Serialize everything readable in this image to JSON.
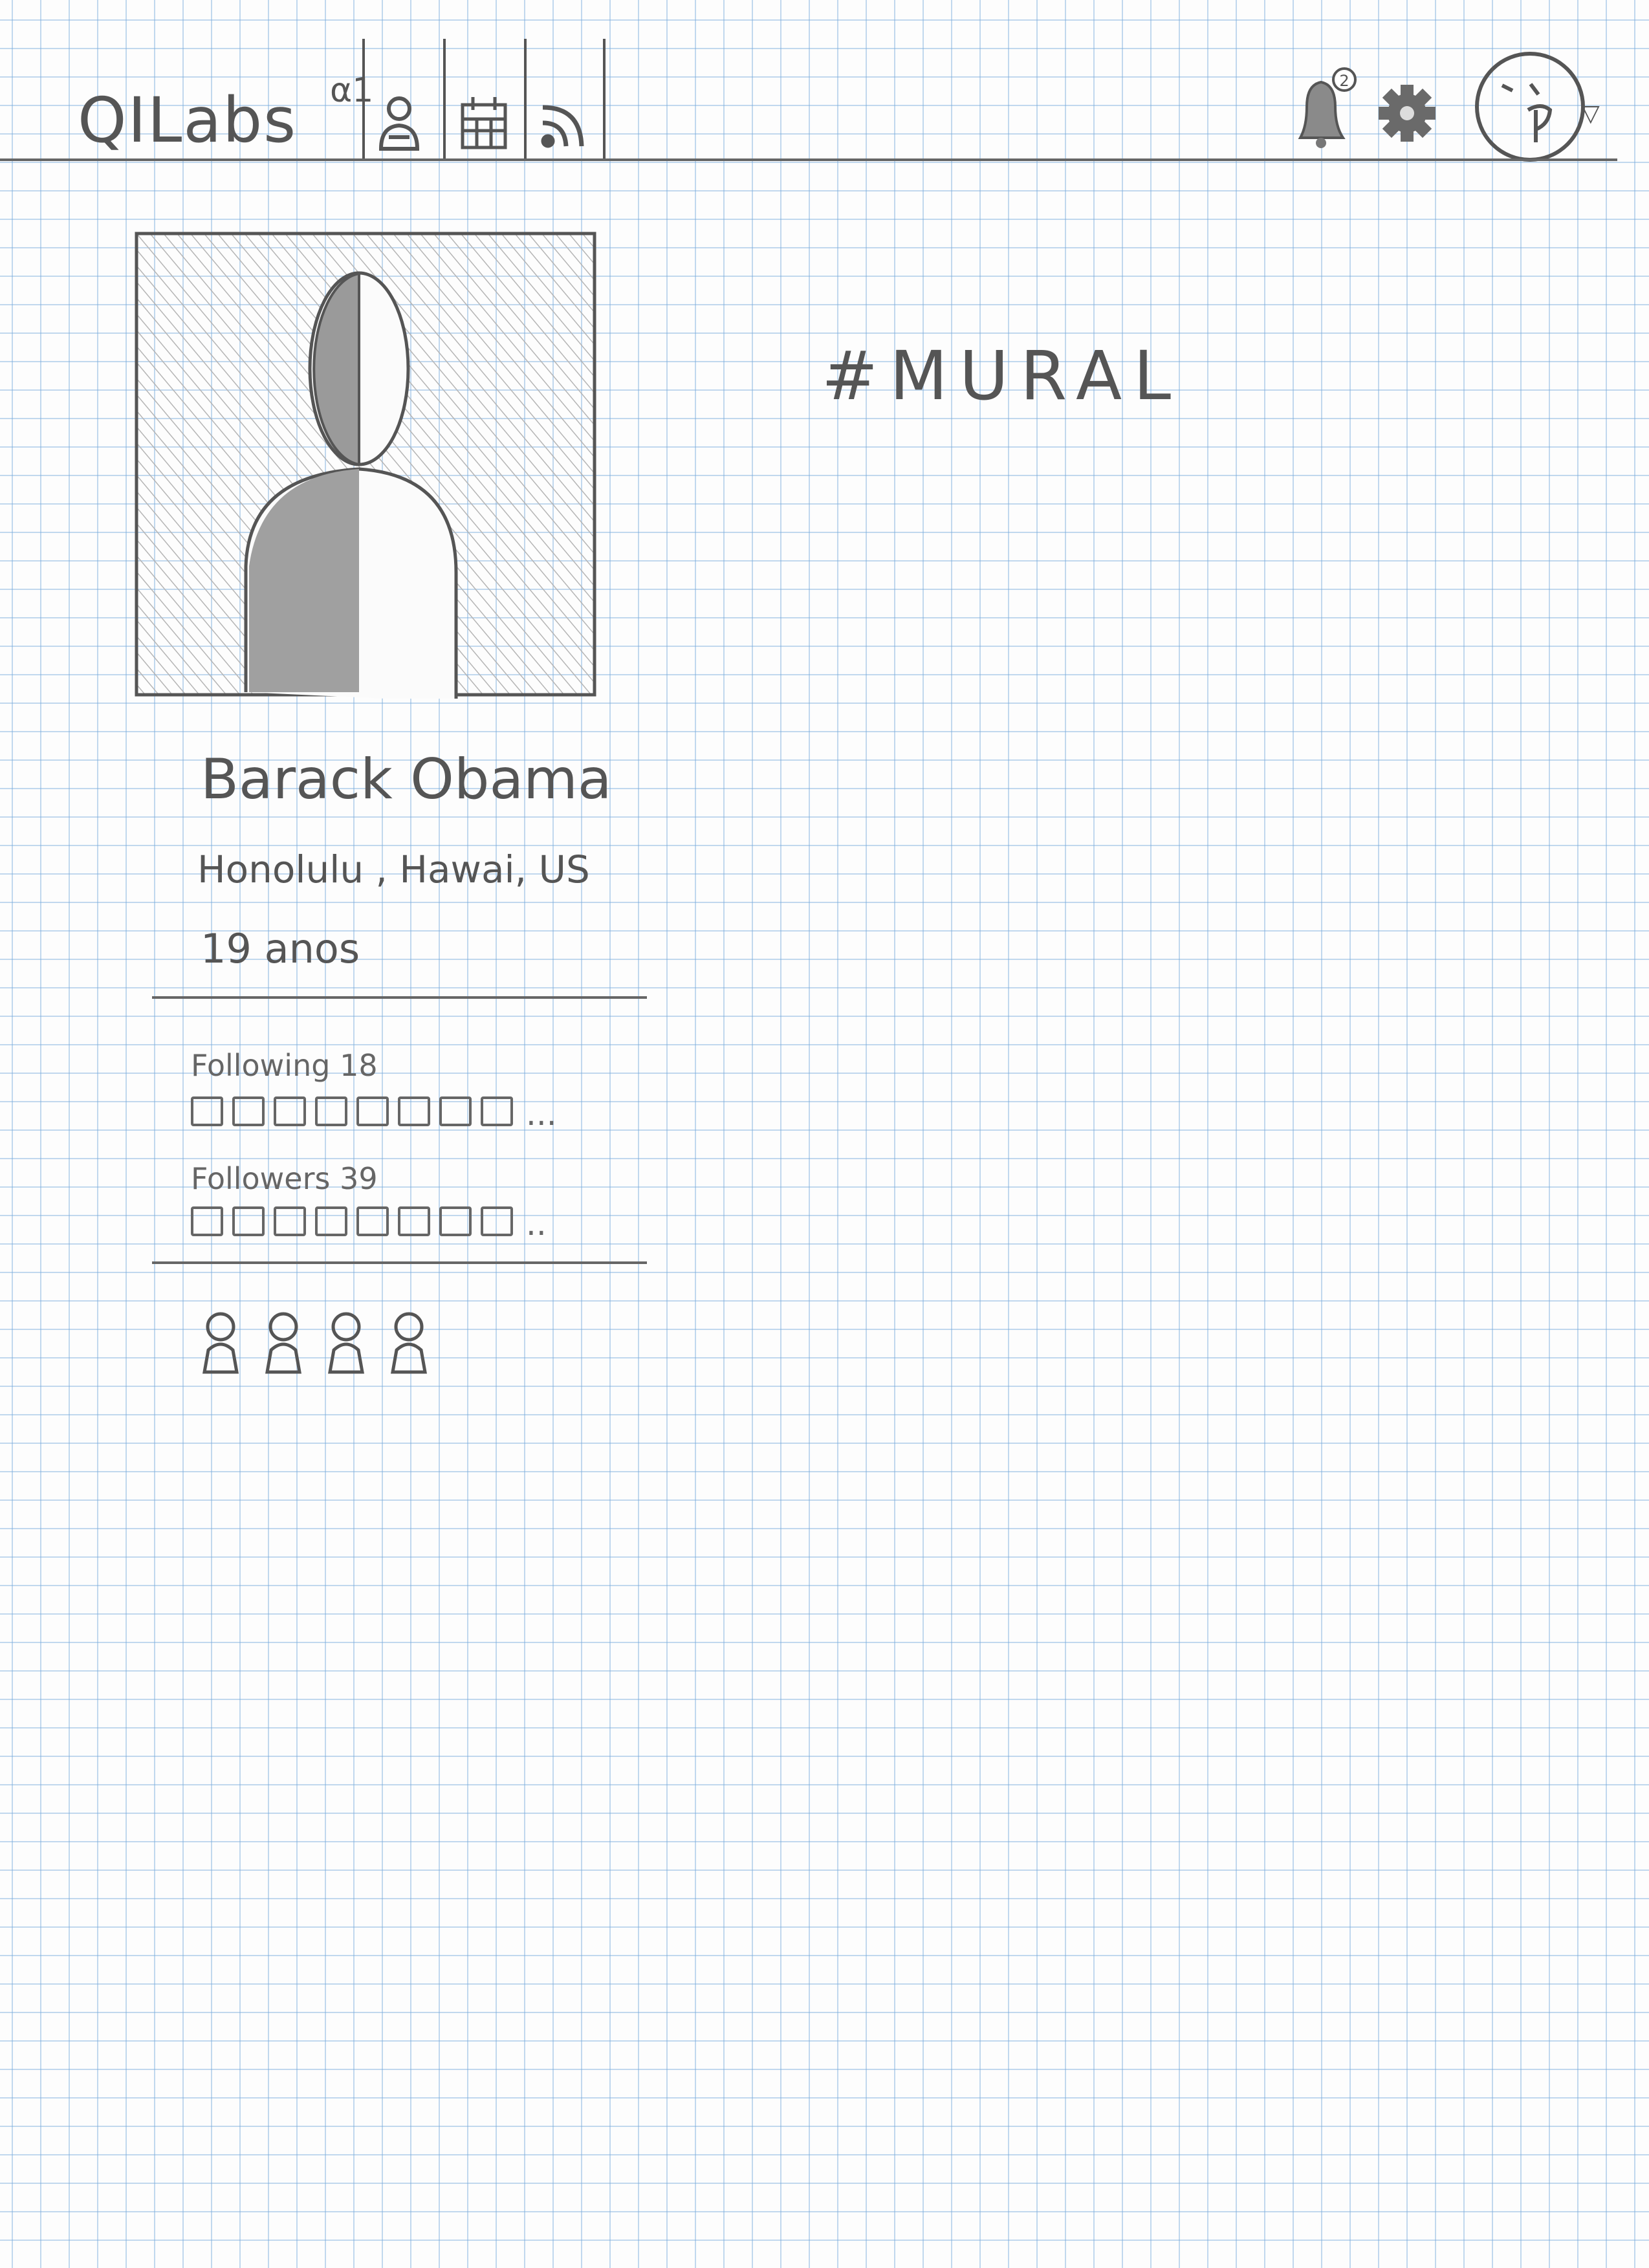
{
  "header": {
    "brand": "QILabs",
    "version": "α1",
    "nav": [
      {
        "name": "nav-friends",
        "icon": "people-icon"
      },
      {
        "name": "nav-calendar",
        "icon": "calendar-icon"
      },
      {
        "name": "nav-feed",
        "icon": "rss-icon"
      }
    ],
    "notifications_icon": "bell-icon",
    "notification_count": "2",
    "settings_icon": "gear-icon",
    "user_icon": "user-avatar-icon",
    "menu_caret": "▽"
  },
  "profile": {
    "photo_icon": "profile-photo-placeholder",
    "name": "Barack Obama",
    "location": "Honolulu , Hawai, US",
    "age": "19 anos"
  },
  "following": {
    "label": "Following",
    "count": "18",
    "thumbnails_shown": 8,
    "more": "..."
  },
  "followers": {
    "label": "Followers",
    "count": "39",
    "thumbnails_shown": 8,
    "more": ".."
  },
  "people_icons": 4,
  "mural": {
    "title": "#MURAL"
  }
}
